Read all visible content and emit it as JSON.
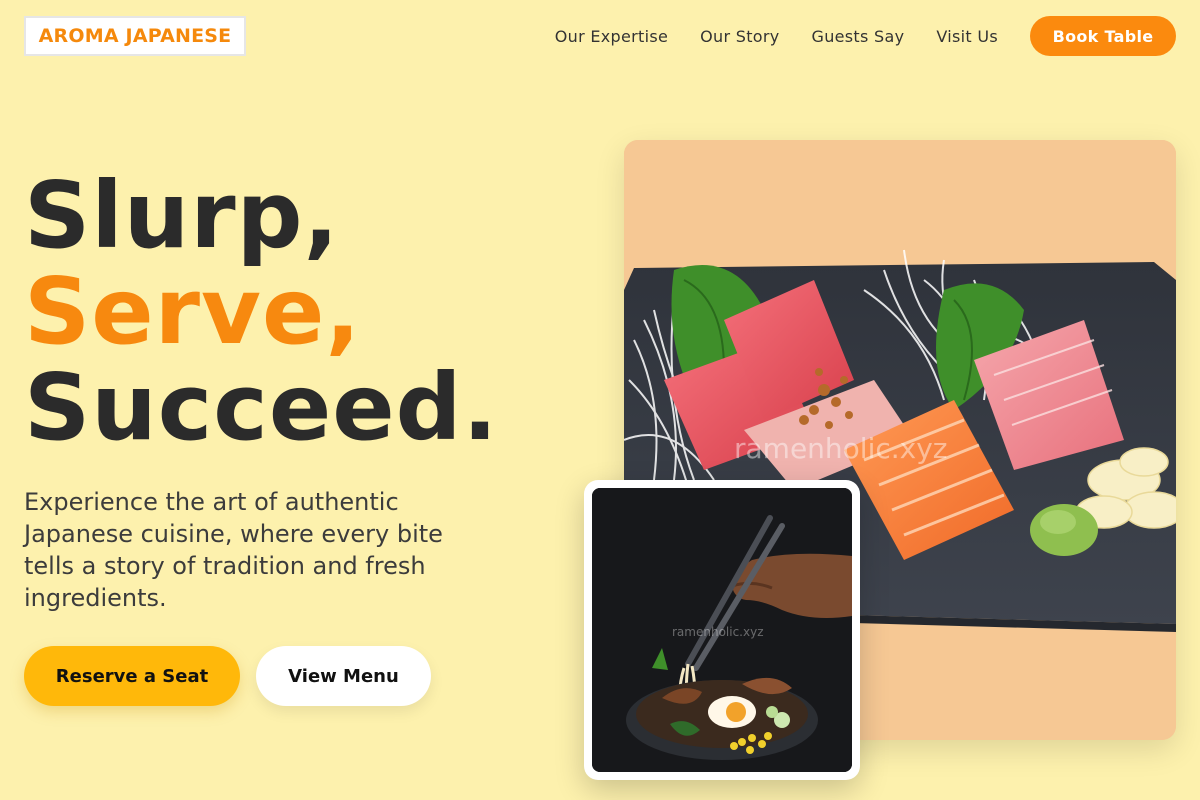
{
  "brand": {
    "logo_text": "AROMA JAPANESE",
    "accent_color": "#f7890f"
  },
  "nav": {
    "links": [
      "Our Expertise",
      "Our Story",
      "Guests Say",
      "Visit Us"
    ],
    "cta_label": "Book Table"
  },
  "hero": {
    "headline": [
      "Slurp,",
      "Serve,",
      "Succeed."
    ],
    "subtext": "Experience the art of authentic Japanese cuisine, where every bite tells a story of tradition and fresh ingredients.",
    "primary_button": "Reserve a Seat",
    "secondary_button": "View Menu"
  },
  "images": {
    "main_watermark": "ramenholic.xyz",
    "card_watermark": "ramenholic.xyz"
  }
}
